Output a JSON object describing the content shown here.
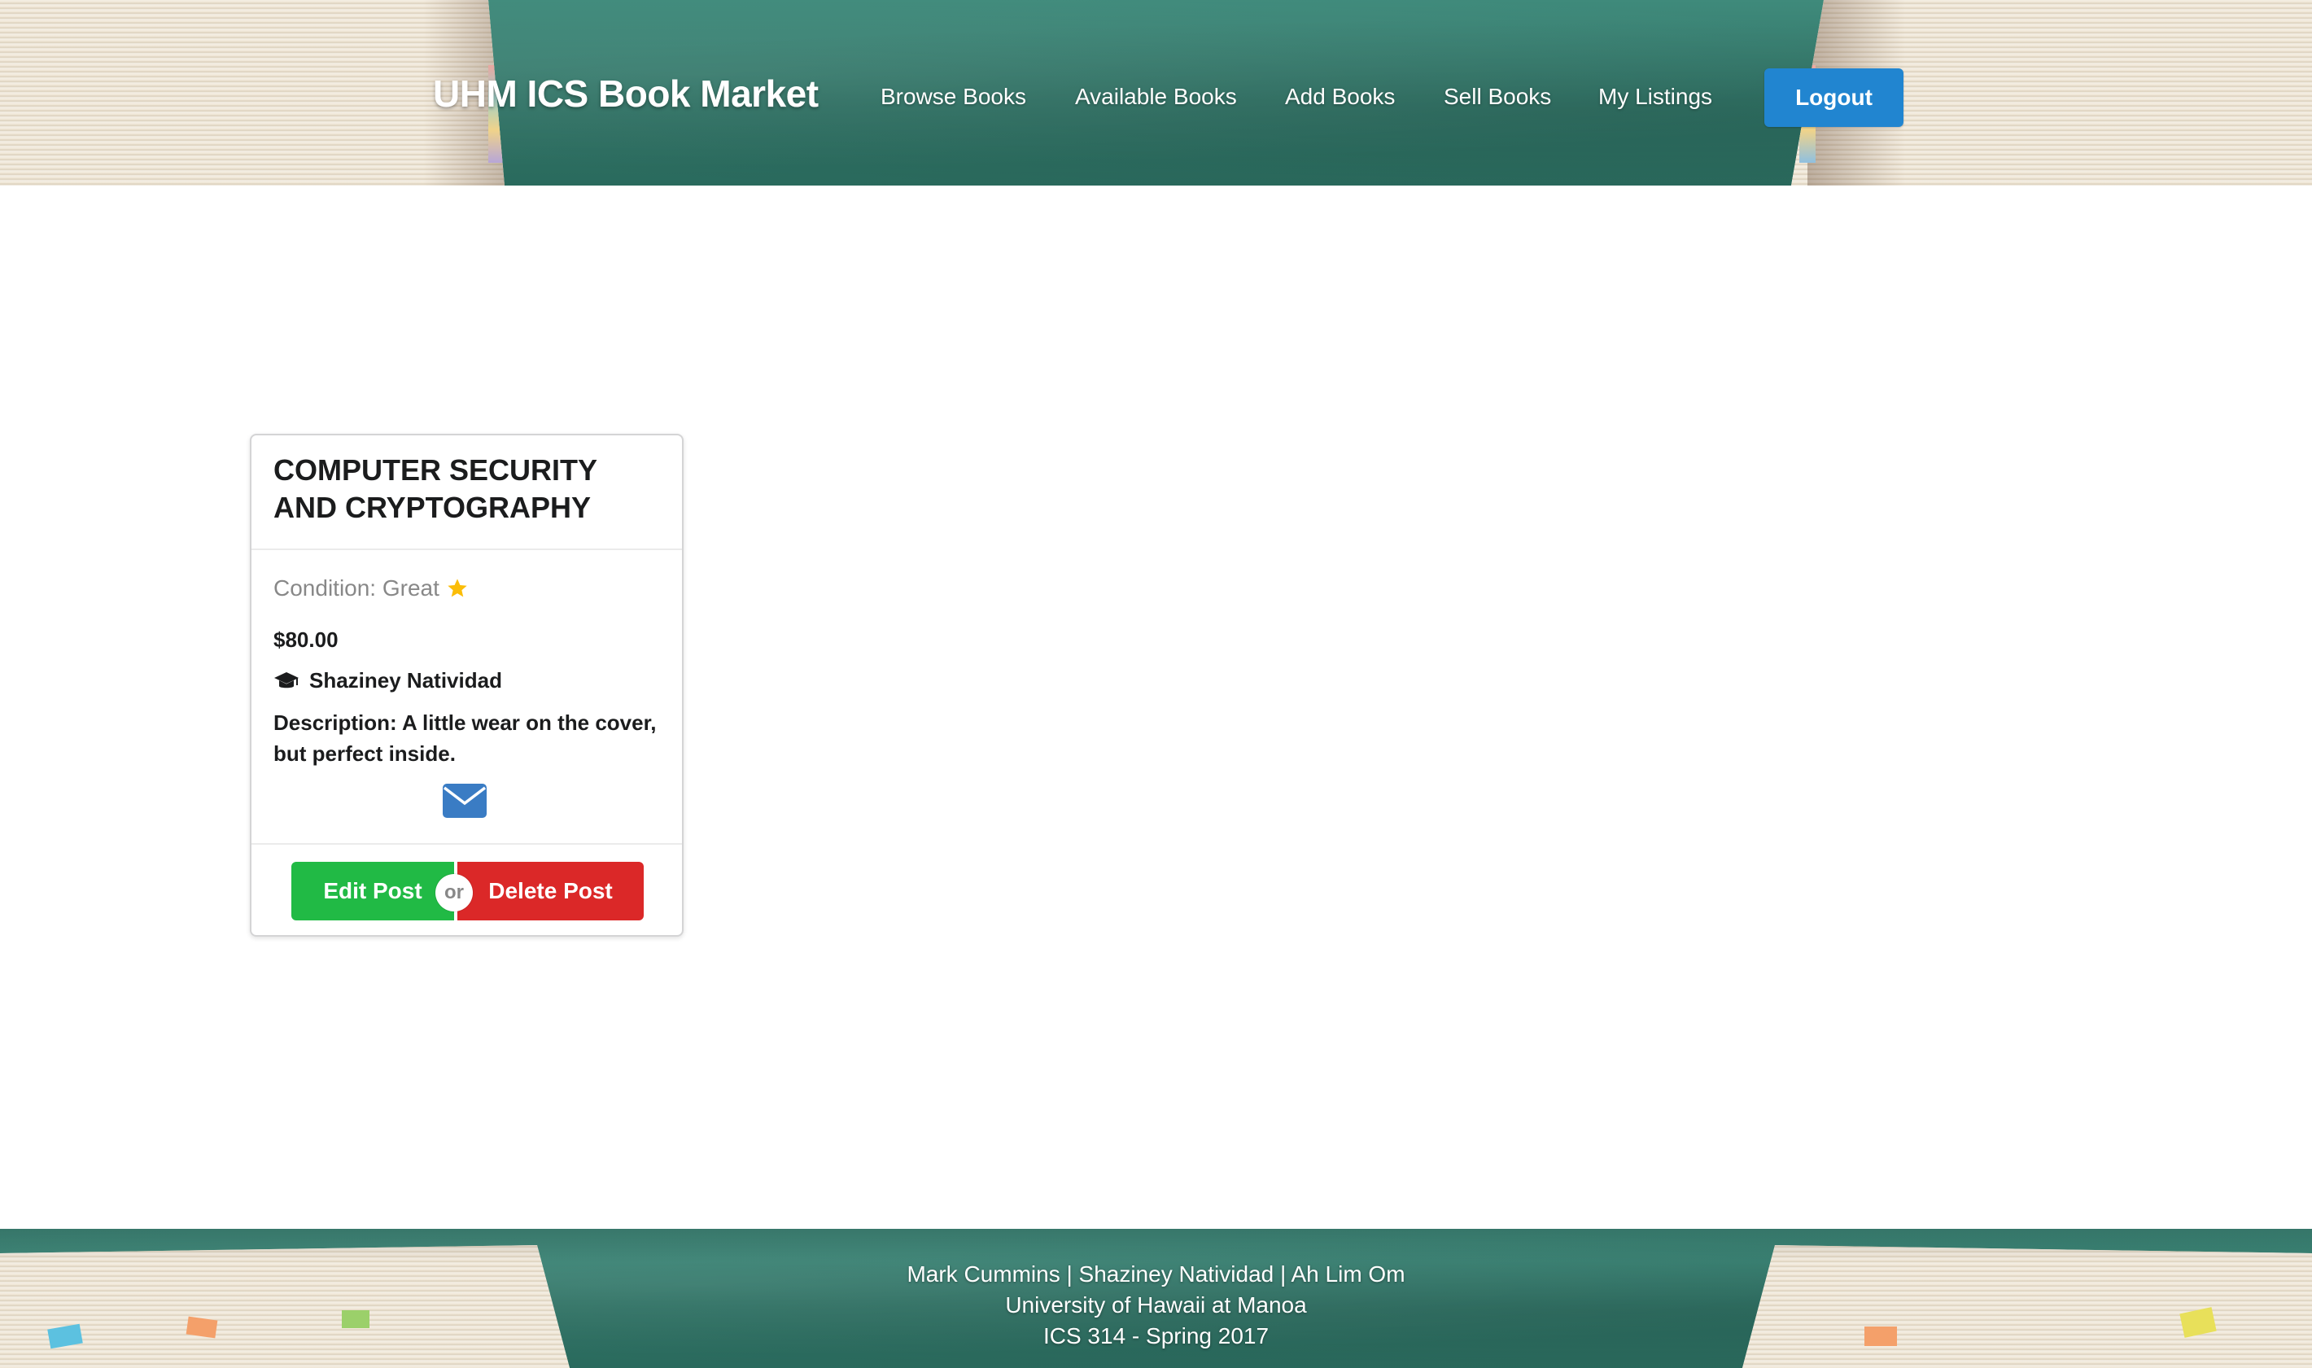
{
  "header": {
    "brand": "UHM ICS Book Market",
    "nav": {
      "browse": "Browse Books",
      "available": "Available Books",
      "add": "Add Books",
      "sell": "Sell Books",
      "listings": "My Listings"
    },
    "logout_label": "Logout"
  },
  "listing": {
    "title": "COMPUTER SECURITY AND CRYPTOGRAPHY",
    "condition": "Condition: Great",
    "price": "$80.00",
    "seller": "Shaziney Natividad",
    "description": "Description: A little wear on the cover, but perfect inside.",
    "edit_label": "Edit Post",
    "or_label": "or",
    "delete_label": "Delete Post",
    "icons": {
      "condition": "star-icon",
      "seller": "graduation-cap-icon",
      "contact": "envelope-icon"
    }
  },
  "footer": {
    "authors": "Mark Cummins | Shaziney Natividad | Ah Lim Om",
    "university": "University of Hawaii at Manoa",
    "course": "ICS 314 - Spring 2017"
  },
  "colors": {
    "primary": "#2185d0",
    "positive": "#21ba45",
    "negative": "#db2828",
    "star": "#fbbd08",
    "chalkboard": "#2f7466"
  }
}
